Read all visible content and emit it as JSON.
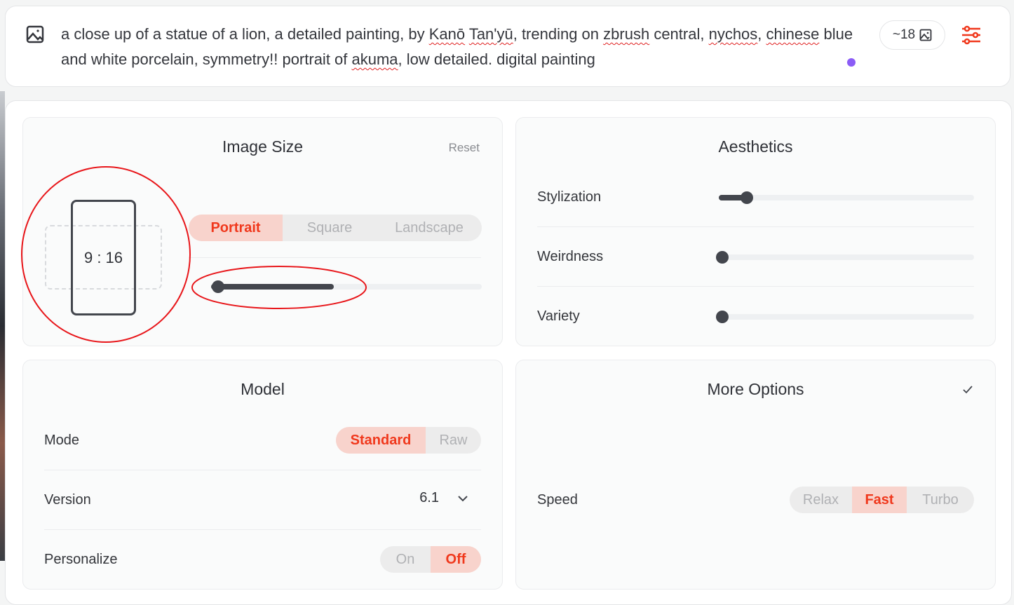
{
  "prompt": {
    "text_parts": [
      {
        "t": "a close up of a statue of a lion, a detailed painting, by ",
        "sq": false
      },
      {
        "t": "Kanō",
        "sq": true
      },
      {
        "t": " ",
        "sq": false
      },
      {
        "t": "Tan'yū",
        "sq": true
      },
      {
        "t": ", trending on ",
        "sq": false
      },
      {
        "t": "zbrush",
        "sq": true
      },
      {
        "t": " central, ",
        "sq": false
      },
      {
        "t": "nychos",
        "sq": true
      },
      {
        "t": ", ",
        "sq": false
      },
      {
        "t": "chinese",
        "sq": true
      },
      {
        "t": " blue and white porcelain, symmetry!! portrait of ",
        "sq": false
      },
      {
        "t": "akuma",
        "sq": true
      },
      {
        "t": ", low detailed. digital painting",
        "sq": false
      }
    ],
    "image_count": "~18"
  },
  "image_size": {
    "title": "Image Size",
    "reset": "Reset",
    "ratio": "9 : 16",
    "orientations": [
      "Portrait",
      "Square",
      "Landscape"
    ],
    "selected": "Portrait",
    "size_slider_fill": 0.43
  },
  "aesthetics": {
    "title": "Aesthetics",
    "sliders": [
      {
        "label": "Stylization",
        "value": 0.11
      },
      {
        "label": "Weirdness",
        "value": 0
      },
      {
        "label": "Variety",
        "value": 0
      }
    ]
  },
  "model": {
    "title": "Model",
    "mode_label": "Mode",
    "modes": [
      "Standard",
      "Raw"
    ],
    "mode_selected": "Standard",
    "version_label": "Version",
    "version": "6.1",
    "personalize_label": "Personalize",
    "personalize": [
      "On",
      "Off"
    ],
    "personalize_selected": "Off"
  },
  "more_options": {
    "title": "More Options",
    "speed_label": "Speed",
    "speeds": [
      "Relax",
      "Fast",
      "Turbo"
    ],
    "speed_selected": "Fast"
  },
  "colors": {
    "accent": "#f0381c",
    "accent_bg": "#f8d3cc",
    "annotation": "#e8161a",
    "dot": "#8b5cf6"
  }
}
